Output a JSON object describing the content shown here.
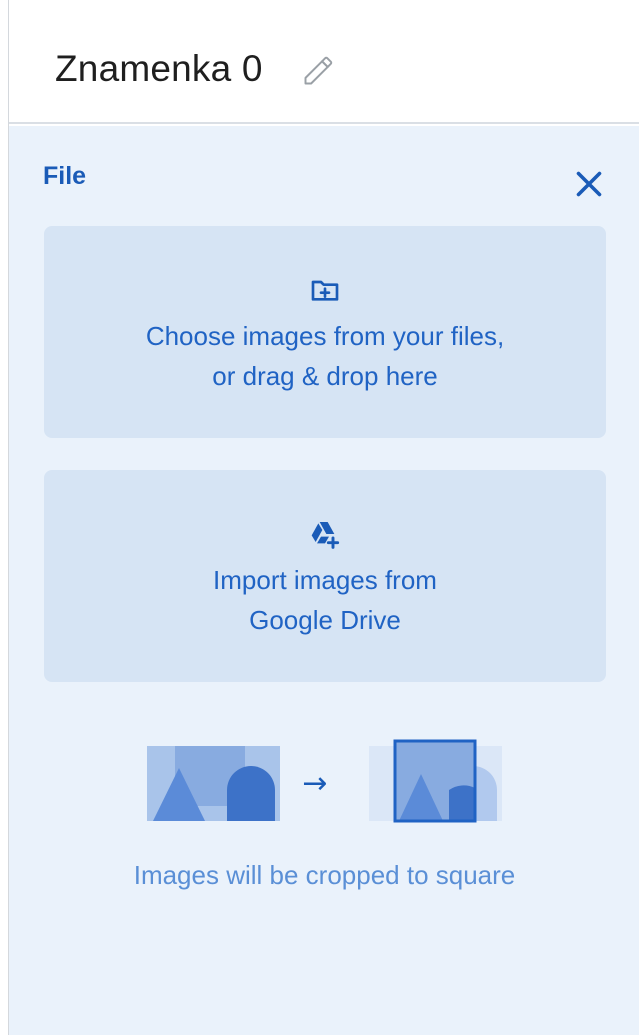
{
  "header": {
    "title": "Znamenka 0",
    "edit_icon": "pencil-icon"
  },
  "panel": {
    "section_label": "File",
    "close_icon": "close-icon",
    "choose_card": {
      "icon": "folder-plus-icon",
      "line1": "Choose images from your files,",
      "line2": "or drag & drop here"
    },
    "drive_card": {
      "icon": "google-drive-add-icon",
      "line1": "Import images from",
      "line2": "Google Drive"
    },
    "crop_illustration_icon": "crop-to-square-illustration",
    "arrow_glyph": "→",
    "crop_hint": "Images will be cropped to square"
  },
  "colors": {
    "accent": "#1a5bb7",
    "card_bg": "#d6e4f4",
    "panel_bg": "#eaf2fb",
    "hint_text": "#5a8fd6"
  }
}
